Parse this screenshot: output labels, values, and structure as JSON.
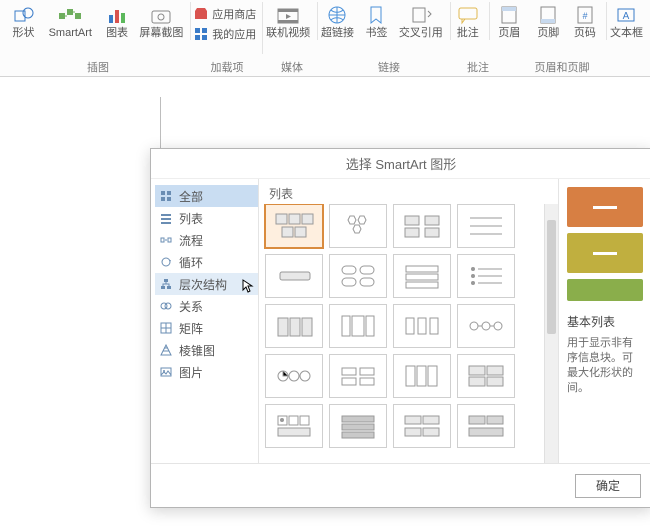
{
  "ribbon": {
    "buttons": {
      "shapes": "形状",
      "smartart": "SmartArt",
      "chart": "图表",
      "screenshot": "屏幕截图",
      "appstore": "应用商店",
      "myapps": "我的应用",
      "online_video": "联机视频",
      "hyperlink": "超链接",
      "bookmark": "书签",
      "crossref": "交叉引用",
      "comment": "批注",
      "header": "页眉",
      "footer": "页脚",
      "page_number": "页码",
      "textbox": "文本框"
    },
    "groups": {
      "illustrations": "插图",
      "addins": "加载项",
      "media": "媒体",
      "links": "链接",
      "comments": "批注",
      "headerfooter": "页眉和页脚"
    }
  },
  "dialog": {
    "title": "选择 SmartArt 图形",
    "categories": [
      "全部",
      "列表",
      "流程",
      "循环",
      "层次结构",
      "关系",
      "矩阵",
      "棱锥图",
      "图片"
    ],
    "gallery_header": "列表",
    "preview_title": "基本列表",
    "preview_desc": "用于显示非有序信息块。可最大化形状的间。",
    "ok": "确定"
  }
}
